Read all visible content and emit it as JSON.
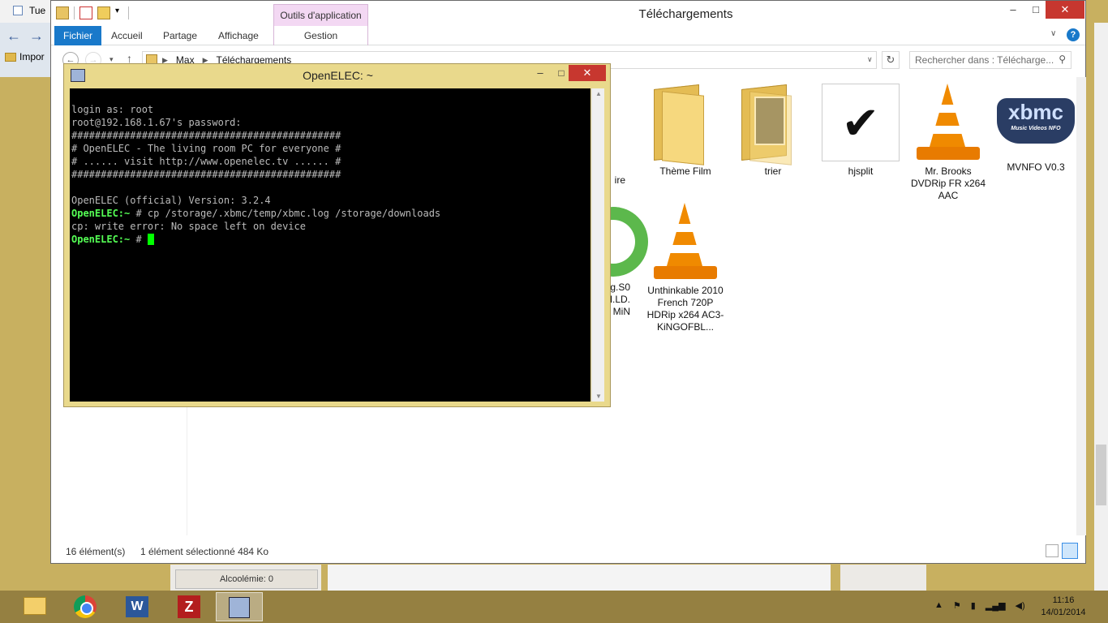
{
  "background_browser": {
    "tab_label": "Tue",
    "favorites_label": "Impor"
  },
  "explorer": {
    "title": "Téléchargements",
    "tools_context_tab": "Outils d'application",
    "ribbon_tabs": {
      "file": "Fichier",
      "home": "Accueil",
      "share": "Partage",
      "view": "Affichage",
      "manage": "Gestion"
    },
    "address": {
      "crumb_root": "Max",
      "crumb_current": "Téléchargements"
    },
    "search": {
      "placeholder": "Rechercher dans : Télécharge..."
    },
    "items": [
      {
        "label": "Thème Film",
        "icon": "folder-icon"
      },
      {
        "label": "trier",
        "icon": "folder-photo-icon"
      },
      {
        "label": "hjsplit",
        "icon": "checkmark-icon"
      },
      {
        "label": "Mr. Brooks DVDRip FR x264 AAC",
        "icon": "vlc-cone-icon"
      },
      {
        "label": "MVNFO V0.3",
        "icon": "xbmc-logo-icon"
      },
      {
        "label": "Unthinkable 2010 French 720P HDRip x264 AC3-KiNGOFBL...",
        "icon": "vlc-cone-icon"
      }
    ],
    "partial_labels": {
      "a": "ire",
      "b": "g.S0",
      "c": "H.LD.",
      "d": "MiN"
    },
    "xbmc_logo_text": "xbmc",
    "xbmc_logo_sub": "Music Videos NFO",
    "status": {
      "count": "16 élément(s)",
      "selection": "1 élément sélectionné  484 Ko"
    }
  },
  "below_panel": {
    "label": "Alcoolémie: 0"
  },
  "putty": {
    "title": "OpenELEC: ~",
    "lines": {
      "l1": "login as: root",
      "l2": "root@192.168.1.67's password:",
      "l3": "##############################################",
      "l4": "# OpenELEC - The living room PC for everyone #",
      "l5": "# ...... visit http://www.openelec.tv ...... #",
      "l6": "##############################################",
      "l7": "",
      "l8": "OpenELEC (official) Version: 3.2.4",
      "l9_prompt": "OpenELEC:~",
      "l9_cmd": " # cp /storage/.xbmc/temp/xbmc.log /storage/downloads",
      "l10": "cp: write error: No space left on device",
      "l11_prompt": "OpenELEC:~",
      "l11_cmd": " # "
    }
  },
  "taskbar": {
    "word_letter": "W",
    "filezilla_letter": "Z",
    "clock_time": "11:16",
    "clock_date": "14/01/2014"
  }
}
